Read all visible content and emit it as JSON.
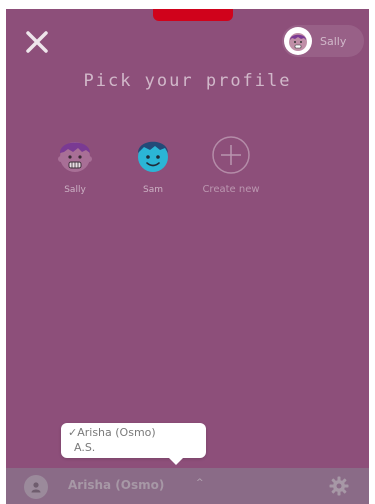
{
  "header": {
    "user_name": "Sally"
  },
  "main": {
    "heading": "Pick your profile",
    "profiles": [
      {
        "name": "Sally"
      },
      {
        "name": "Sam"
      }
    ],
    "create_new_label": "Create new"
  },
  "account_popover": {
    "options": [
      {
        "label": "✓Arisha (Osmo)",
        "selected": true
      },
      {
        "label": "A.S.",
        "selected": false
      }
    ]
  },
  "bottom_bar": {
    "account_label": "Arisha (Osmo)",
    "caret": "^"
  },
  "colors": {
    "background": "#8d4f7a",
    "top_tab": "#d0021b",
    "bottom_bar": "#8a6b87",
    "sally_hair": "#7a3a93",
    "sam_face": "#2bb5d6"
  }
}
